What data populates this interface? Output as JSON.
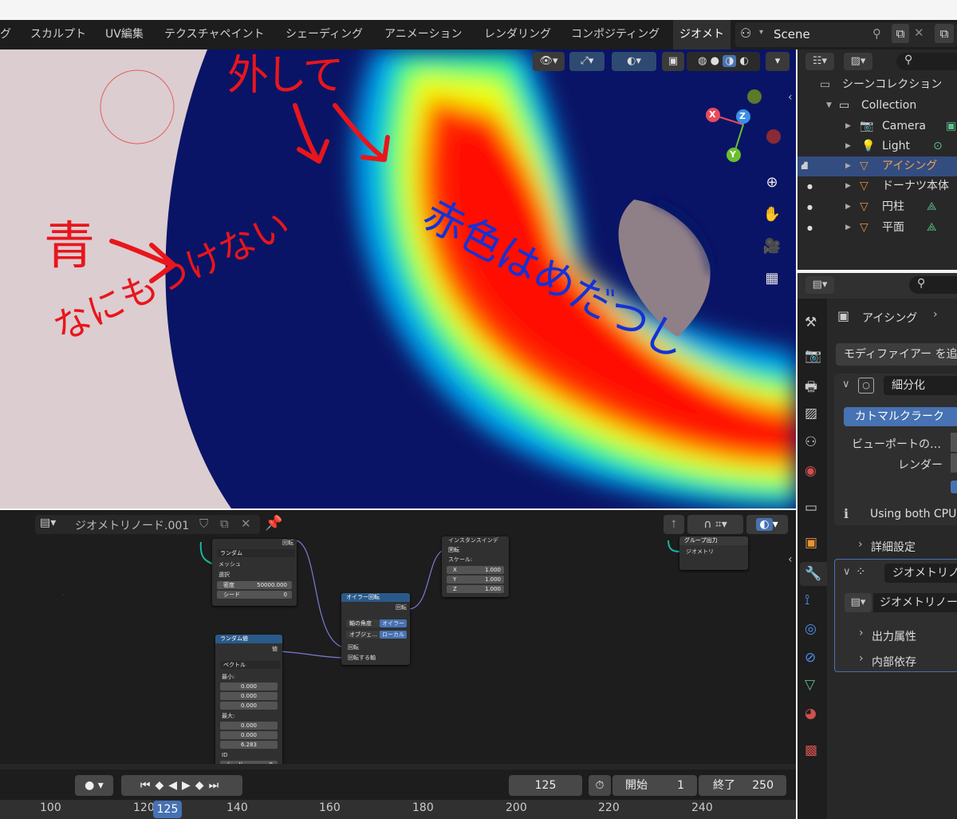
{
  "topbar": {
    "tabs": [
      "グ",
      "スカルプト",
      "UV編集",
      "テクスチャペイント",
      "シェーディング",
      "アニメーション",
      "レンダリング",
      "コンポジティング",
      "ジオメト"
    ],
    "scene_name": "Scene"
  },
  "viewport": {
    "annotations": {
      "top": "外して",
      "left1": "青",
      "left2": "なにもつけない",
      "center": "赤色はめだつし"
    },
    "gizmo_axes": {
      "x": "X",
      "y": "Y",
      "z": "Z"
    }
  },
  "outliner": {
    "root": "シーンコレクション",
    "collection": "Collection",
    "items": [
      "Camera",
      "Light",
      "アイシング",
      "ドーナツ本体",
      "円柱",
      "平面"
    ]
  },
  "properties": {
    "object_name": "アイシング",
    "add_modifier": "モディファイアー を追加",
    "subdiv_name": "細分化",
    "subdiv_mode": "カトマルクラーク",
    "viewport_label": "ビューポートの…",
    "render_label": "レンダー",
    "info_text": "Using both CPU",
    "advanced": "詳細設定",
    "geonodes_name": "ジオメトリノ",
    "geonodes_tree": "ジオメトリノー",
    "output_attrs": "出力属性",
    "internal_deps": "内部依存"
  },
  "node_editor": {
    "tree_name": "ジオメトリノード.001",
    "distribute": {
      "mode": "ランダム",
      "mesh": "メッシュ",
      "selection": "選択",
      "density_label": "密度",
      "density": "50000.000",
      "seed_label": "シード",
      "seed": "0",
      "rot_out": "回転"
    },
    "instance": {
      "title": "インスタンスインデッ…",
      "rotation": "回転",
      "scale": "スケール:",
      "x_label": "X",
      "x": "1.000",
      "y_label": "Y",
      "y": "1.000",
      "z_label": "Z",
      "z": "1.000"
    },
    "euler": {
      "title": "オイラー回転",
      "out": "回転",
      "axis_label": "軸の角度",
      "axis_val": "オイラー",
      "space_label": "オブジェ…",
      "space_val": "ローカル",
      "rot_in": "回転",
      "rot_by": "回転する軸"
    },
    "random": {
      "title": "ランダム値",
      "out": "値",
      "type": "ベクトル",
      "min": "最小:",
      "min_vals": [
        "0.000",
        "0.000",
        "0.000"
      ],
      "max": "最大:",
      "max_vals": [
        "0.000",
        "0.000",
        "6.283"
      ],
      "id": "ID",
      "seed": "シード",
      "seed_val": "0"
    },
    "group_out": {
      "title": "グループ出力",
      "geometry": "ジオメトリ"
    }
  },
  "timeline": {
    "current_frame": "125",
    "start_label": "開始",
    "start": "1",
    "end_label": "終了",
    "end": "250",
    "ticks": [
      "100",
      "120",
      "140",
      "160",
      "180",
      "200",
      "220",
      "240"
    ],
    "playhead": "125"
  },
  "colors": {
    "accent": "#4772b3",
    "annotation_red": "#e8161c",
    "annotation_blue": "#1332d8"
  }
}
